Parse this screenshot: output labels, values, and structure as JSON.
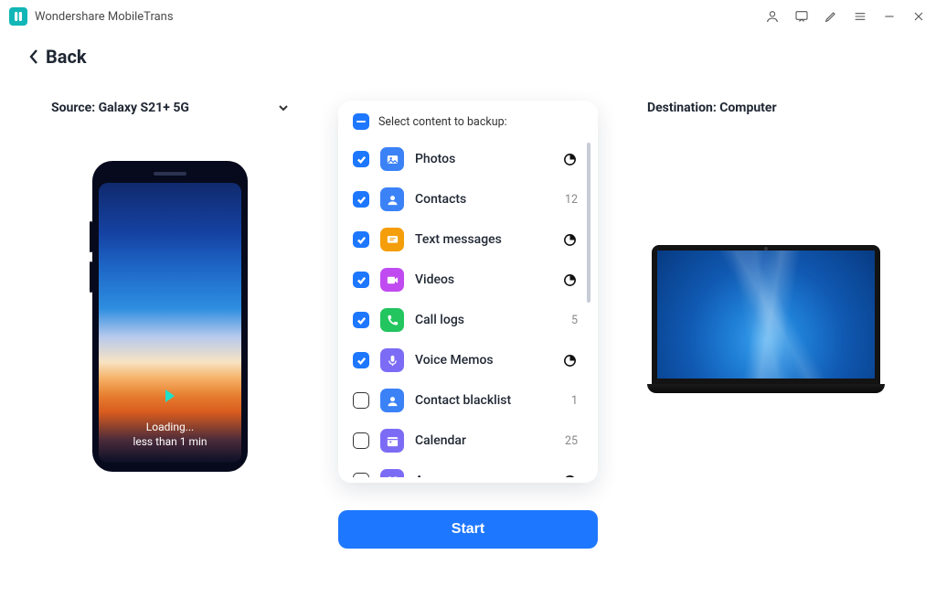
{
  "app": {
    "title": "Wondershare MobileTrans"
  },
  "nav": {
    "back": "Back"
  },
  "source": {
    "label": "Source: Galaxy S21+ 5G"
  },
  "destination": {
    "label": "Destination: Computer"
  },
  "phone": {
    "status_line1": "Loading...",
    "status_line2": "less than 1 min"
  },
  "card": {
    "header": "Select content to backup:"
  },
  "items": [
    {
      "label": "Photos",
      "checked": true,
      "count": "",
      "loading": true,
      "icon": "image",
      "bg": "#3b82f6"
    },
    {
      "label": "Contacts",
      "checked": true,
      "count": "12",
      "loading": false,
      "icon": "contact",
      "bg": "#3b82f6"
    },
    {
      "label": "Text messages",
      "checked": true,
      "count": "",
      "loading": true,
      "icon": "message",
      "bg": "#f59e0b"
    },
    {
      "label": "Videos",
      "checked": true,
      "count": "",
      "loading": true,
      "icon": "video",
      "bg": "#c04bf0"
    },
    {
      "label": "Call logs",
      "checked": true,
      "count": "5",
      "loading": false,
      "icon": "phone",
      "bg": "#22c55e"
    },
    {
      "label": "Voice Memos",
      "checked": true,
      "count": "",
      "loading": true,
      "icon": "mic",
      "bg": "#7c6cf5"
    },
    {
      "label": "Contact blacklist",
      "checked": false,
      "count": "1",
      "loading": false,
      "icon": "contact",
      "bg": "#3b82f6"
    },
    {
      "label": "Calendar",
      "checked": false,
      "count": "25",
      "loading": false,
      "icon": "calendar",
      "bg": "#7c6cf5"
    },
    {
      "label": "Apps",
      "checked": false,
      "count": "",
      "loading": true,
      "icon": "apps",
      "bg": "#7c6cf5"
    }
  ],
  "action": {
    "start": "Start"
  }
}
